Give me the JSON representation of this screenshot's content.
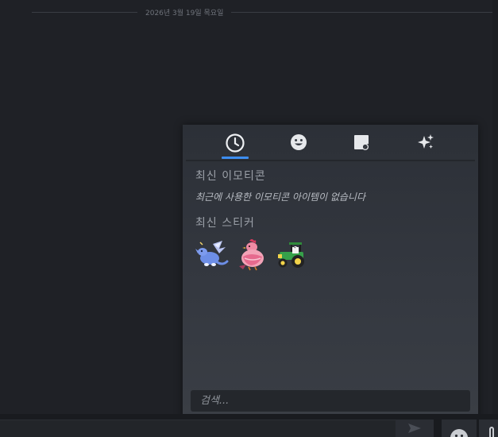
{
  "chat": {
    "date_divider": "2026년 3월 19일 목요일"
  },
  "emoticon_panel": {
    "tabs": [
      {
        "name": "recent",
        "icon": "clock-icon",
        "active": true
      },
      {
        "name": "emoji",
        "icon": "smiley-icon",
        "active": false
      },
      {
        "name": "stickers",
        "icon": "sticker-icon",
        "active": false
      },
      {
        "name": "effects",
        "icon": "sparkles-icon",
        "active": false
      }
    ],
    "recent_emoticons_title": "최신 이모티콘",
    "recent_emoticons_empty": "최근에 사용한 이모티콘 아이템이 없습니다",
    "recent_stickers_title": "최신 스티커",
    "stickers": [
      {
        "icon": "blue-dragon-sticker-icon"
      },
      {
        "icon": "pink-chicken-sticker-icon"
      },
      {
        "icon": "green-tractor-sticker-icon"
      }
    ],
    "search_placeholder": "검색..."
  },
  "colors": {
    "accent": "#3d8ef0",
    "panel_bg": "#343840",
    "app_bg": "#1f2126"
  }
}
